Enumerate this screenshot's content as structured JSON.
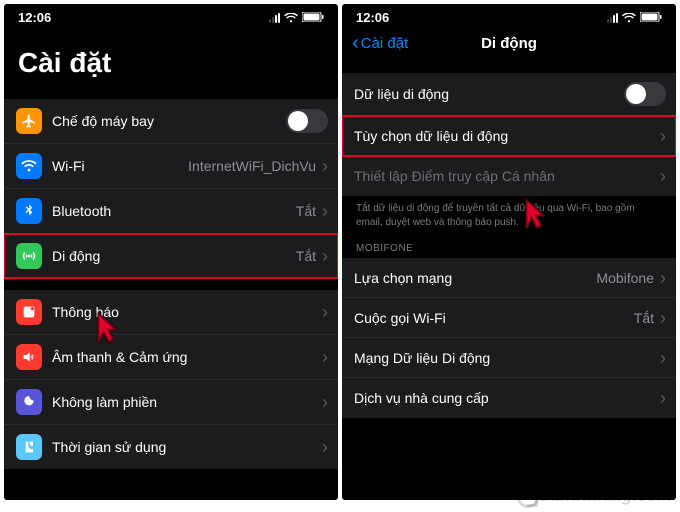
{
  "status": {
    "time": "12:06"
  },
  "left": {
    "title": "Cài đặt",
    "rows": {
      "airplane": "Chế độ máy bay",
      "wifi": "Wi-Fi",
      "wifi_val": "InternetWiFi_DichVu",
      "bt": "Bluetooth",
      "bt_val": "Tắt",
      "cell": "Di động",
      "cell_val": "Tắt",
      "notif": "Thông báo",
      "sound": "Âm thanh & Cảm ứng",
      "dnd": "Không làm phiền",
      "screentime": "Thời gian sử dụng"
    }
  },
  "right": {
    "back": "Cài đặt",
    "title": "Di động",
    "rows": {
      "data": "Dữ liệu di động",
      "dataopts": "Tùy chọn dữ liệu di động",
      "hotspot": "Thiết lập Điểm truy cập Cá nhân",
      "note": "Tắt dữ liệu di động để truyền tất cả dữ liệu qua Wi-Fi, bao gồm email, duyệt web và thông báo push.",
      "carrier_section": "MOBIFONE",
      "netsel": "Lựa chọn mạng",
      "netsel_val": "Mobifone",
      "wificall": "Cuộc gọi Wi-Fi",
      "wificall_val": "Tắt",
      "cellnet": "Mạng Dữ liệu Di động",
      "services": "Dịch vụ nhà cung cấp"
    }
  },
  "watermark": "uantrimang.com"
}
